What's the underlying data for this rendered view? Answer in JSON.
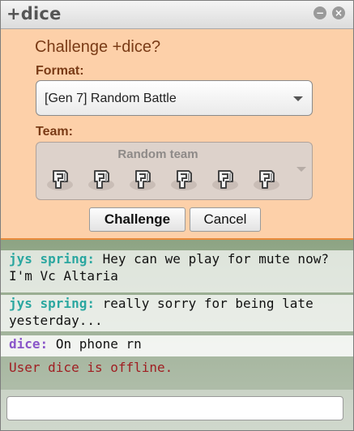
{
  "window": {
    "title": "+dice",
    "minimize_label": "−",
    "close_label": "×"
  },
  "challenge": {
    "heading": "Challenge +dice?",
    "format_label": "Format:",
    "format_value": "[Gen 7] Random Battle",
    "team_label": "Team:",
    "team_value": "Random team",
    "team_slots": [
      "unknown-pokemon-icon",
      "unknown-pokemon-icon",
      "unknown-pokemon-icon",
      "unknown-pokemon-icon",
      "unknown-pokemon-icon",
      "unknown-pokemon-icon"
    ],
    "challenge_button": "Challenge",
    "cancel_button": "Cancel"
  },
  "chat": {
    "messages": [
      {
        "user": "jys spring:",
        "text": "Hey can we play for mute now? I'm Vc Altaria",
        "color": "#2ba7a0"
      },
      {
        "user": "jys spring:",
        "text": "really sorry for being late yesterday...",
        "color": "#2ba7a0"
      },
      {
        "user": "dice:",
        "text": "On phone rn",
        "color": "#8a56c9"
      }
    ],
    "system": "User dice is offline.",
    "input_value": "",
    "input_placeholder": ""
  },
  "colors": {
    "challenge_bg": "#fdd0a9",
    "accent": "#e88b3d",
    "offline": "#a01e22"
  }
}
